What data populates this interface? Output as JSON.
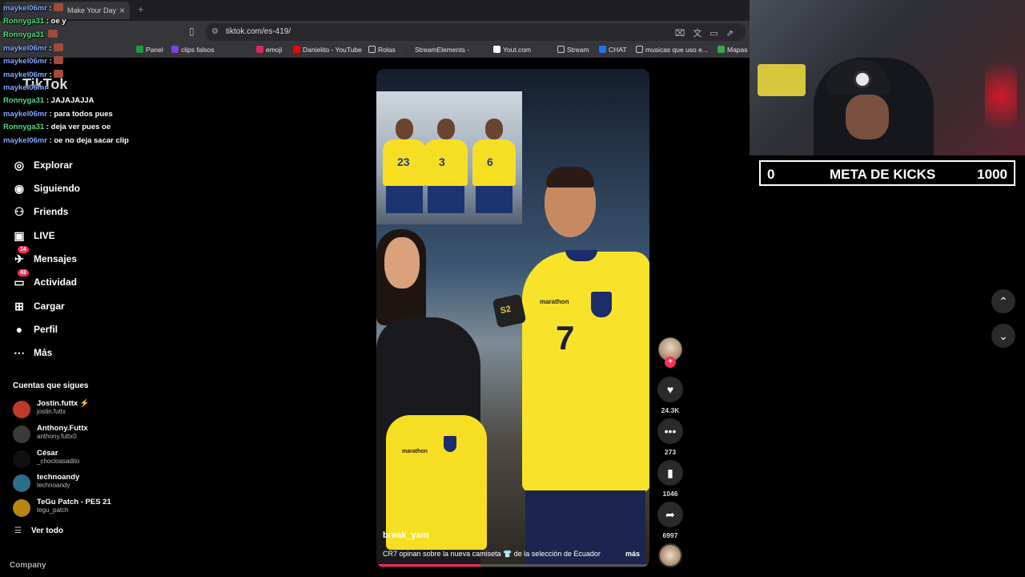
{
  "browser": {
    "tab_title": "Make Your Day",
    "url": "tiktok.com/es-419/",
    "bookmarks": [
      {
        "label": "Panel",
        "color": "#1e9e3a"
      },
      {
        "label": "clips falsos",
        "color": "#7b3fe4"
      },
      {
        "label": "emoji",
        "color": "#e0245e"
      },
      {
        "label": "Danielito - YouTube",
        "color": "#ff0000"
      },
      {
        "label": "Rolas",
        "color": ""
      },
      {
        "label": "StreamElements -",
        "color": "#333"
      },
      {
        "label": "Yout.com",
        "color": "#fff"
      },
      {
        "label": "Stream",
        "color": ""
      },
      {
        "label": "CHAT",
        "color": "#1877f2"
      },
      {
        "label": "musicas que uso e...",
        "color": ""
      },
      {
        "label": "Mapas",
        "color": "#34a853"
      }
    ]
  },
  "chat": [
    {
      "user": "maykel06mr",
      "msg": ":",
      "color": "#7fa8ff",
      "emote": true
    },
    {
      "user": "Ronnyga31",
      "msg": ": oe y",
      "color": "#4ade80",
      "emote": false
    },
    {
      "user": "Ronnyga31",
      "msg": "",
      "color": "#4ade80",
      "emote": true
    },
    {
      "user": "maykel06mr",
      "msg": ":",
      "color": "#7fa8ff",
      "emote": true
    },
    {
      "user": "maykel06mr",
      "msg": ":",
      "color": "#7fa8ff",
      "emote": true
    },
    {
      "user": "maykel06mr",
      "msg": ":",
      "color": "#7fa8ff",
      "emote": true
    },
    {
      "user": "maykel06mr",
      "msg": "",
      "color": "#7fa8ff",
      "emote": false
    },
    {
      "user": "Ronnyga31",
      "msg": ": JAJAJAJJA",
      "color": "#4ade80",
      "emote": false
    },
    {
      "user": "maykel06mr",
      "msg": ": para todos pues",
      "color": "#7fa8ff",
      "emote": false
    },
    {
      "user": "Ronnyga31",
      "msg": ": deja ver pues oe",
      "color": "#4ade80",
      "emote": false
    },
    {
      "user": "maykel06mr",
      "msg": ": oe no deja sacar clip",
      "color": "#7fa8ff",
      "emote": false
    }
  ],
  "sidebar": {
    "logo": "TikTok",
    "nav": [
      {
        "label": "Explorar",
        "icon": "compass-icon",
        "glyph": "◎",
        "badge": ""
      },
      {
        "label": "Siguiendo",
        "icon": "following-icon",
        "glyph": "◉",
        "badge": ""
      },
      {
        "label": "Friends",
        "icon": "friends-icon",
        "glyph": "⚇",
        "badge": ""
      },
      {
        "label": "LIVE",
        "icon": "live-icon",
        "glyph": "▣",
        "badge": ""
      },
      {
        "label": "Mensajes",
        "icon": "messages-icon",
        "glyph": "✈",
        "badge": "14"
      },
      {
        "label": "Actividad",
        "icon": "activity-icon",
        "glyph": "▭",
        "badge": "43"
      },
      {
        "label": "Cargar",
        "icon": "upload-icon",
        "glyph": "⊞",
        "badge": ""
      },
      {
        "label": "Perfil",
        "icon": "profile-icon",
        "glyph": "●",
        "badge": ""
      },
      {
        "label": "Más",
        "icon": "more-icon",
        "glyph": "⋯",
        "badge": ""
      }
    ],
    "following_title": "Cuentas que sigues",
    "following": [
      {
        "name": "Jostin.futtx ⚡",
        "handle": "jostin.futtx",
        "color": "#c0392b"
      },
      {
        "name": "Anthony.Futtx",
        "handle": "anthony.futtx0",
        "color": "#3a3a3a"
      },
      {
        "name": "César",
        "handle": "_chocloasadito",
        "color": "#111"
      },
      {
        "name": "technoandy",
        "handle": "technoandy",
        "color": "#2c6e8a"
      },
      {
        "name": "TeGu Patch - PES 21",
        "handle": "tegu_patch",
        "color": "#b8860b"
      }
    ],
    "see_all": "Ver todo",
    "company": "Company"
  },
  "video": {
    "username": "break_yam",
    "caption": "CR7 opinan sobre la nueva camiseta 👕 de la selección de Ecuador",
    "more": "más",
    "progress": 0.38,
    "inset_numbers": [
      "23",
      "3",
      "6"
    ],
    "player_number": "7",
    "brand": "marathon",
    "mic_text": "S2"
  },
  "actions": {
    "likes": "24.3K",
    "comments": "273",
    "saves": "1046",
    "shares": "6997"
  },
  "overlay": {
    "kicks_current": "0",
    "kicks_title": "META DE KICKS",
    "kicks_goal": "1000"
  }
}
